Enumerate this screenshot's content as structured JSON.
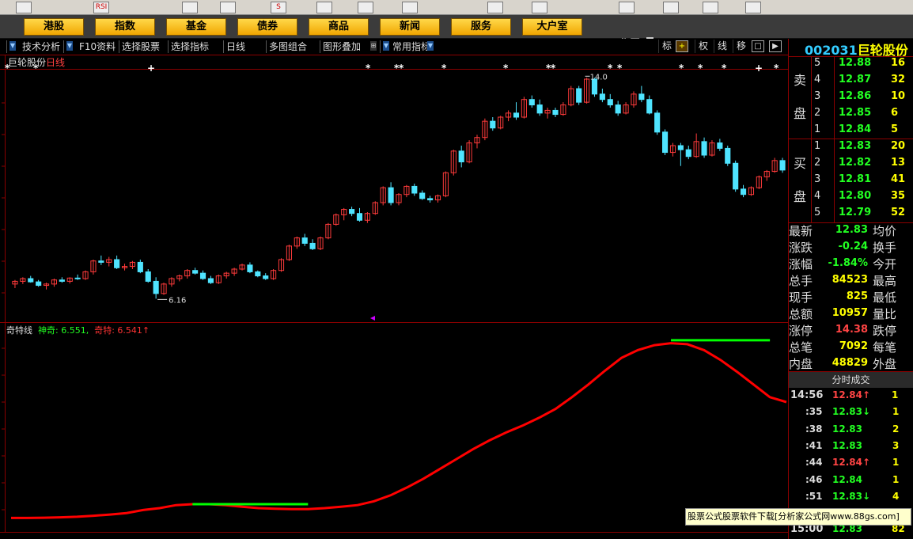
{
  "topbar": {
    "icons": [
      "hk-icon",
      "rsi-icon",
      "diamond-icon",
      "pen-icon",
      "s-icon",
      "flag-icon",
      "tree-icon",
      "stock-icon",
      "heart-icon",
      "globe-icon",
      "doc-icon",
      "chart-icon",
      "bars-icon",
      "help-icon"
    ],
    "icon_texts": [
      "",
      "RSI",
      "",
      "",
      "S",
      "",
      "",
      "",
      "",
      "",
      "",
      "",
      "",
      ""
    ]
  },
  "nav": {
    "buttons": [
      "港股",
      "指数",
      "基金",
      "债券",
      "商品",
      "新闻",
      "服务",
      "大户室"
    ],
    "workarea": "工作区"
  },
  "toolbar": {
    "items": [
      "技术分析",
      "F10资料",
      "选择股票",
      "选择指标",
      "日线",
      "多图组合",
      "图形叠加",
      "常用指标"
    ],
    "right_buttons": [
      "标",
      "+",
      "权",
      "线",
      "移",
      "□",
      "▶"
    ]
  },
  "chart": {
    "name": "巨轮股份",
    "period": "日线",
    "high_label": "14.0",
    "low_label": "6.16",
    "indicator": {
      "name": "奇特线",
      "s1_label": "神奇",
      "s1_value": "6.551",
      "s2_label": "奇特",
      "s2_value": "6.541↑"
    },
    "colors": {
      "up": "#ff3b3b",
      "down": "#4fe4ff",
      "line1": "#ff0000",
      "line2": "#00ff00",
      "grid": "#8b0000"
    }
  },
  "chart_data": {
    "type": "candlestick",
    "candles": [
      [
        6.7,
        6.85,
        6.55,
        6.8
      ],
      [
        6.8,
        6.95,
        6.7,
        6.9
      ],
      [
        6.9,
        7.0,
        6.75,
        6.78
      ],
      [
        6.78,
        6.85,
        6.6,
        6.65
      ],
      [
        6.65,
        6.75,
        6.5,
        6.7
      ],
      [
        6.7,
        6.9,
        6.6,
        6.85
      ],
      [
        6.85,
        6.95,
        6.75,
        6.8
      ],
      [
        6.8,
        6.95,
        6.72,
        6.92
      ],
      [
        6.92,
        7.05,
        6.85,
        6.9
      ],
      [
        6.9,
        7.2,
        6.85,
        7.15
      ],
      [
        7.15,
        7.6,
        7.05,
        7.55
      ],
      [
        7.55,
        7.75,
        7.4,
        7.5
      ],
      [
        7.5,
        7.7,
        7.35,
        7.6
      ],
      [
        7.6,
        7.75,
        7.25,
        7.3
      ],
      [
        7.3,
        7.45,
        7.2,
        7.35
      ],
      [
        7.35,
        7.55,
        7.25,
        7.5
      ],
      [
        7.5,
        7.6,
        7.1,
        7.15
      ],
      [
        7.15,
        7.25,
        6.75,
        6.8
      ],
      [
        6.8,
        6.95,
        6.16,
        6.35
      ],
      [
        6.35,
        6.75,
        6.3,
        6.7
      ],
      [
        6.7,
        6.95,
        6.6,
        6.9
      ],
      [
        6.9,
        7.05,
        6.8,
        7.0
      ],
      [
        7.0,
        7.25,
        6.9,
        7.2
      ],
      [
        7.2,
        7.3,
        7.05,
        7.1
      ],
      [
        7.1,
        7.2,
        6.85,
        6.9
      ],
      [
        6.9,
        7.0,
        6.7,
        6.75
      ],
      [
        6.75,
        7.05,
        6.7,
        7.0
      ],
      [
        7.0,
        7.15,
        6.9,
        7.1
      ],
      [
        7.1,
        7.3,
        7.0,
        7.25
      ],
      [
        7.25,
        7.45,
        7.2,
        7.4
      ],
      [
        7.4,
        7.5,
        7.1,
        7.15
      ],
      [
        7.15,
        7.2,
        6.95,
        7.0
      ],
      [
        7.0,
        7.1,
        6.85,
        6.9
      ],
      [
        6.9,
        7.25,
        6.85,
        7.2
      ],
      [
        7.2,
        7.65,
        7.15,
        7.6
      ],
      [
        7.6,
        8.15,
        7.55,
        8.1
      ],
      [
        8.1,
        8.45,
        8.0,
        8.4
      ],
      [
        8.4,
        8.55,
        8.1,
        8.2
      ],
      [
        8.2,
        8.35,
        7.95,
        8.0
      ],
      [
        8.0,
        8.45,
        7.95,
        8.4
      ],
      [
        8.4,
        8.95,
        8.35,
        8.9
      ],
      [
        8.9,
        9.3,
        8.85,
        9.25
      ],
      [
        9.25,
        9.5,
        9.05,
        9.45
      ],
      [
        9.45,
        9.55,
        9.2,
        9.3
      ],
      [
        9.3,
        9.5,
        9.0,
        9.05
      ],
      [
        9.05,
        9.35,
        8.95,
        9.3
      ],
      [
        9.3,
        9.75,
        9.25,
        9.7
      ],
      [
        9.7,
        10.3,
        9.6,
        10.25
      ],
      [
        10.25,
        10.45,
        9.6,
        9.7
      ],
      [
        9.7,
        10.05,
        9.6,
        10.0
      ],
      [
        10.0,
        10.35,
        9.9,
        10.3
      ],
      [
        10.3,
        10.4,
        9.95,
        10.05
      ],
      [
        10.05,
        10.15,
        9.8,
        9.85
      ],
      [
        9.85,
        9.95,
        9.7,
        9.8
      ],
      [
        9.8,
        10.0,
        9.7,
        9.95
      ],
      [
        9.95,
        10.85,
        9.9,
        10.8
      ],
      [
        10.8,
        11.65,
        10.7,
        11.6
      ],
      [
        11.6,
        11.8,
        11.0,
        11.2
      ],
      [
        11.2,
        12.0,
        11.15,
        11.9
      ],
      [
        11.9,
        12.2,
        11.7,
        12.1
      ],
      [
        12.1,
        12.8,
        12.0,
        12.7
      ],
      [
        12.7,
        12.85,
        12.35,
        12.45
      ],
      [
        12.45,
        12.9,
        12.4,
        12.85
      ],
      [
        12.85,
        13.1,
        12.7,
        13.0
      ],
      [
        13.0,
        13.4,
        12.75,
        12.85
      ],
      [
        12.85,
        13.6,
        12.8,
        13.5
      ],
      [
        13.5,
        13.65,
        13.2,
        13.3
      ],
      [
        13.3,
        13.5,
        12.9,
        13.0
      ],
      [
        13.0,
        13.2,
        12.8,
        13.1
      ],
      [
        13.1,
        13.2,
        12.85,
        12.95
      ],
      [
        12.95,
        13.4,
        12.9,
        13.3
      ],
      [
        13.3,
        14.0,
        13.25,
        13.9
      ],
      [
        13.9,
        14.0,
        13.3,
        13.4
      ],
      [
        13.4,
        14.3,
        13.35,
        14.25
      ],
      [
        14.25,
        14.3,
        13.6,
        13.7
      ],
      [
        13.7,
        13.9,
        13.4,
        13.5
      ],
      [
        13.5,
        13.7,
        13.2,
        13.3
      ],
      [
        13.3,
        13.45,
        12.9,
        13.0
      ],
      [
        13.0,
        13.4,
        12.95,
        13.3
      ],
      [
        13.3,
        13.8,
        13.2,
        13.7
      ],
      [
        13.7,
        14.0,
        13.4,
        13.5
      ],
      [
        13.5,
        13.65,
        12.95,
        13.0
      ],
      [
        13.0,
        13.1,
        12.2,
        12.3
      ],
      [
        12.3,
        12.4,
        11.45,
        11.55
      ],
      [
        11.55,
        11.9,
        11.4,
        11.8
      ],
      [
        11.8,
        11.9,
        11.05,
        11.65
      ],
      [
        11.65,
        11.8,
        11.3,
        11.4
      ],
      [
        11.4,
        12.25,
        11.35,
        11.95
      ],
      [
        11.95,
        12.1,
        11.35,
        11.45
      ],
      [
        11.45,
        12.0,
        11.4,
        11.9
      ],
      [
        11.9,
        12.05,
        11.6,
        11.7
      ],
      [
        11.7,
        11.8,
        11.05,
        11.15
      ],
      [
        11.15,
        11.25,
        10.1,
        10.2
      ],
      [
        10.2,
        10.35,
        9.9,
        10.0
      ],
      [
        10.0,
        10.3,
        9.95,
        10.25
      ],
      [
        10.25,
        10.7,
        10.2,
        10.65
      ],
      [
        10.65,
        10.9,
        10.5,
        10.85
      ],
      [
        10.85,
        11.35,
        10.8,
        11.25
      ],
      [
        11.25,
        11.35,
        10.8,
        10.9
      ]
    ],
    "price_range": [
      5.5,
      14.6
    ],
    "indicator_range": [
      6.0,
      16.0
    ],
    "line1": [
      6.55,
      6.55,
      6.56,
      6.58,
      6.61,
      6.66,
      6.72,
      6.8,
      6.95,
      7.05,
      7.2,
      7.25,
      7.25,
      7.2,
      7.12,
      7.05,
      7.02,
      7.0,
      7.0,
      7.05,
      7.12,
      7.2,
      7.4,
      7.7,
      8.1,
      8.55,
      9.05,
      9.55,
      10.05,
      10.5,
      10.9,
      11.25,
      11.65,
      12.1,
      12.7,
      13.35,
      14.05,
      14.7,
      15.1,
      15.35,
      15.45,
      15.4,
      15.1,
      14.6,
      14.0,
      13.35,
      12.7,
      12.45
    ],
    "line2_segments": [
      [
        11,
        18,
        7.25
      ],
      [
        40,
        46,
        15.6
      ]
    ],
    "markers": [
      [
        0,
        "*"
      ],
      [
        6,
        "*"
      ],
      [
        30,
        "+"
      ],
      [
        76,
        "*"
      ],
      [
        82,
        "*"
      ],
      [
        83,
        "*"
      ],
      [
        92,
        "*"
      ],
      [
        105,
        "*"
      ],
      [
        114,
        "*"
      ],
      [
        115,
        "*"
      ],
      [
        127,
        "*"
      ],
      [
        129,
        "*"
      ],
      [
        142,
        "*"
      ],
      [
        146,
        "*"
      ],
      [
        151,
        "*"
      ],
      [
        158,
        "+"
      ],
      [
        162,
        "*"
      ]
    ]
  },
  "quote": {
    "code": "002031",
    "name": "巨轮股份",
    "sell_label": [
      "卖",
      "盘"
    ],
    "buy_label": [
      "买",
      "盘"
    ],
    "sell": [
      [
        "5",
        "12.88",
        "16"
      ],
      [
        "4",
        "12.87",
        "32"
      ],
      [
        "3",
        "12.86",
        "10"
      ],
      [
        "2",
        "12.85",
        "6"
      ],
      [
        "1",
        "12.84",
        "5"
      ]
    ],
    "buy": [
      [
        "1",
        "12.83",
        "20"
      ],
      [
        "2",
        "12.82",
        "13"
      ],
      [
        "3",
        "12.81",
        "41"
      ],
      [
        "4",
        "12.80",
        "35"
      ],
      [
        "5",
        "12.79",
        "52"
      ]
    ],
    "stats": [
      [
        "最新",
        "12.83",
        "#2f2",
        "均价"
      ],
      [
        "涨跌",
        "-0.24",
        "#2f2",
        "换手"
      ],
      [
        "涨幅",
        "-1.84%",
        "#2f2",
        "今开"
      ],
      [
        "总手",
        "84523",
        "#ff0",
        "最高"
      ],
      [
        "现手",
        "825",
        "#ff0",
        "最低"
      ],
      [
        "总额",
        "10957",
        "#ff0",
        "量比"
      ],
      [
        "涨停",
        "14.38",
        "#f44",
        "跌停"
      ],
      [
        "总笔",
        "7092",
        "#ff0",
        "每笔"
      ],
      [
        "内盘",
        "48829",
        "#ff0",
        "外盘"
      ]
    ],
    "fs_title": "分时成交",
    "ticks": [
      [
        "14:56",
        "12.84↑",
        "#f44",
        "1"
      ],
      [
        ":35",
        "12.83↓",
        "#2f2",
        "1"
      ],
      [
        ":38",
        "12.83",
        "#2f2",
        "2"
      ],
      [
        ":41",
        "12.83",
        "#2f2",
        "3"
      ],
      [
        ":44",
        "12.84↑",
        "#f44",
        "1"
      ],
      [
        ":46",
        "12.84",
        "#2f2",
        "1"
      ],
      [
        ":51",
        "12.83↓",
        "#2f2",
        "4"
      ],
      [
        "15:00",
        "12.83",
        "#2f2",
        "82"
      ]
    ]
  },
  "banner": "股票公式股票软件下载[分析家公式网www.88gs.com]"
}
